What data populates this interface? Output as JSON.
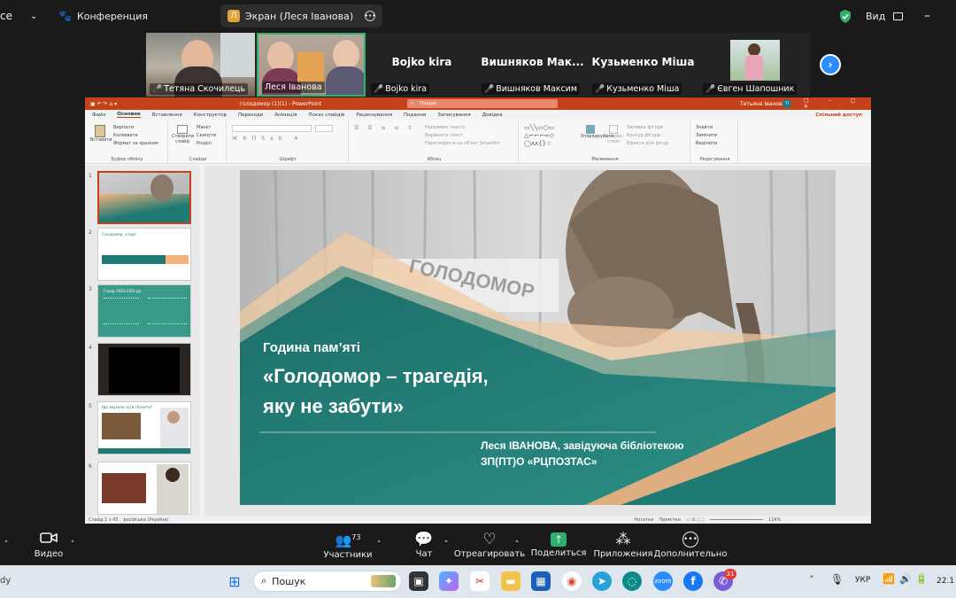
{
  "top": {
    "left_fragment": "ce",
    "conference_label": "Конференция",
    "share_label": "Экран (Леся Іванова)",
    "share_badge": "Л",
    "view_label": "Вид"
  },
  "participants": [
    {
      "name": "Тетяна Скочилець"
    },
    {
      "name": "Леся Іванова"
    },
    {
      "name": "Bojko kira",
      "display": "Bojko kira"
    },
    {
      "name": "Вишняков Максим",
      "display": "Вишняков Мак..."
    },
    {
      "name": "Кузьменко Міша",
      "display": "Кузьменко Міша"
    },
    {
      "name": "Євген Шапошник"
    }
  ],
  "ppt": {
    "title": "голодомор (1)(1) - PowerPoint",
    "search": "Пошук",
    "user": "Тетьяна Іванова",
    "user_initials": "ТІ",
    "share_access": "Спільний доступ",
    "menu": [
      "Файл",
      "Основне",
      "Вставлення",
      "Конструктор",
      "Переходи",
      "Анімація",
      "Показ слайдів",
      "Рецензування",
      "Подання",
      "Записування",
      "Довідка"
    ],
    "ribbon_groups": [
      "Буфер обміну",
      "Слайди",
      "Шрифт",
      "Абзац",
      "Малювання",
      "Редагування"
    ],
    "clipboard": {
      "paste": "Вставити",
      "cut": "Вирізати",
      "copy": "Копіювати",
      "format": "Формат за зразком"
    },
    "slides_grp": {
      "new": "Створити слайд",
      "layout": "Макет",
      "reset": "Скинути",
      "section": "Розділ"
    },
    "paragraph": {
      "dir": "Напрямок тексту",
      "align": "Вирівняти текст",
      "smartart": "Перетворити на об'єкт SmartArt"
    },
    "drawing": {
      "arrange": "Упорядкувати",
      "quick": "Експрес-стилі",
      "fill": "Заливка фігури",
      "outline": "Контур фігури",
      "effects": "Ефекти для фігур"
    },
    "editing": {
      "find": "Знайти",
      "replace": "Замінити",
      "select": "Виділити"
    },
    "thumb_numbers": [
      "1",
      "2",
      "3",
      "4",
      "5",
      "6"
    ],
    "thumb_texts": {
      "t2_title": "Голодомор: історії",
      "t3_title": "Голод 1932-1933 рр.",
      "t5_title": "Що змусило чути і бачити?"
    },
    "status_left": "Слайд 1 з 43",
    "status_lang": "російська (Україна)",
    "status_notes": "Нотатки",
    "status_comments": "Примітки",
    "zoom": "114%"
  },
  "slide": {
    "subtitle": "Година пам’яті",
    "title_line1": "«Голодомор – трагедія,",
    "title_line2": "яку не забути»",
    "author_line1": "Леся ІВАНОВА, завідуюча бібліотекою",
    "author_line2": "ЗП(ПТ)О «РЦПОЗТАС»",
    "sign_text": "ГОЛОДОМОР"
  },
  "toolbar": {
    "video": "Видео",
    "participants": "Участники",
    "participants_count": "73",
    "chat": "Чат",
    "react": "Отреагировать",
    "share": "Поделиться",
    "apps": "Приложения",
    "more": "Дополнительно"
  },
  "taskbar": {
    "left_fragment": "dy",
    "search": "Пошук",
    "lang": "УКР",
    "time_fragment": "22.1",
    "badge": "31"
  },
  "colors": {
    "accent_green": "#2fb06d",
    "ppt_red": "#c4421a",
    "slide_teal": "#1f7a74",
    "slide_peach": "#f2b37f",
    "zoom_blue": "#2d8cff"
  }
}
